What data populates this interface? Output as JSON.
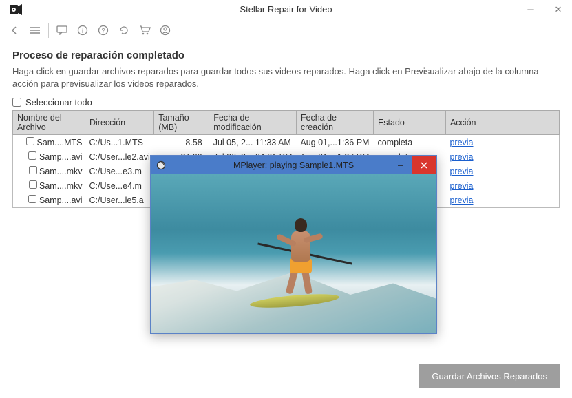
{
  "window": {
    "title": "Stellar Repair for Video"
  },
  "heading": "Proceso de reparación completado",
  "subtext": "Haga click en guardar archivos reparados para guardar todos sus videos reparados. Haga click en Previsualizar abajo de la columna acción para previsualizar los videos reparados.",
  "select_all_label": "Seleccionar todo",
  "columns": {
    "name": "Nombre del Archivo",
    "dir": "Dirección",
    "size": "Tamaño (MB)",
    "mod": "Fecha de modificación",
    "create": "Fecha de creación",
    "status": "Estado",
    "action": "Acción"
  },
  "rows": [
    {
      "name": "Sam....MTS",
      "dir": "C:/Us...1.MTS",
      "size": "8.58",
      "mod": "Jul 05, 2... 11:33 AM",
      "create": "Aug 01,...1:36 PM",
      "status": "completa",
      "action": "previa"
    },
    {
      "name": "Samp....avi",
      "dir": "C:/User...le2.avi",
      "size": "24.99",
      "mod": "Jul 06, 2... 04:31 PM",
      "create": "Aug 01,...1:27 PM",
      "status": "completa",
      "action": "previa"
    },
    {
      "name": "Sam....mkv",
      "dir": "C:/Use...e3.m",
      "size": "",
      "mod": "",
      "create": "",
      "status": "",
      "action": "previa"
    },
    {
      "name": "Sam....mkv",
      "dir": "C:/Use...e4.m",
      "size": "",
      "mod": "",
      "create": "",
      "status": "",
      "action": "previa"
    },
    {
      "name": "Samp....avi",
      "dir": "C:/User...le5.a",
      "size": "",
      "mod": "",
      "create": "",
      "status": "",
      "action": "previa"
    }
  ],
  "save_button": "Guardar Archivos Reparados",
  "mplayer": {
    "title": "MPlayer: playing Sample1.MTS"
  }
}
